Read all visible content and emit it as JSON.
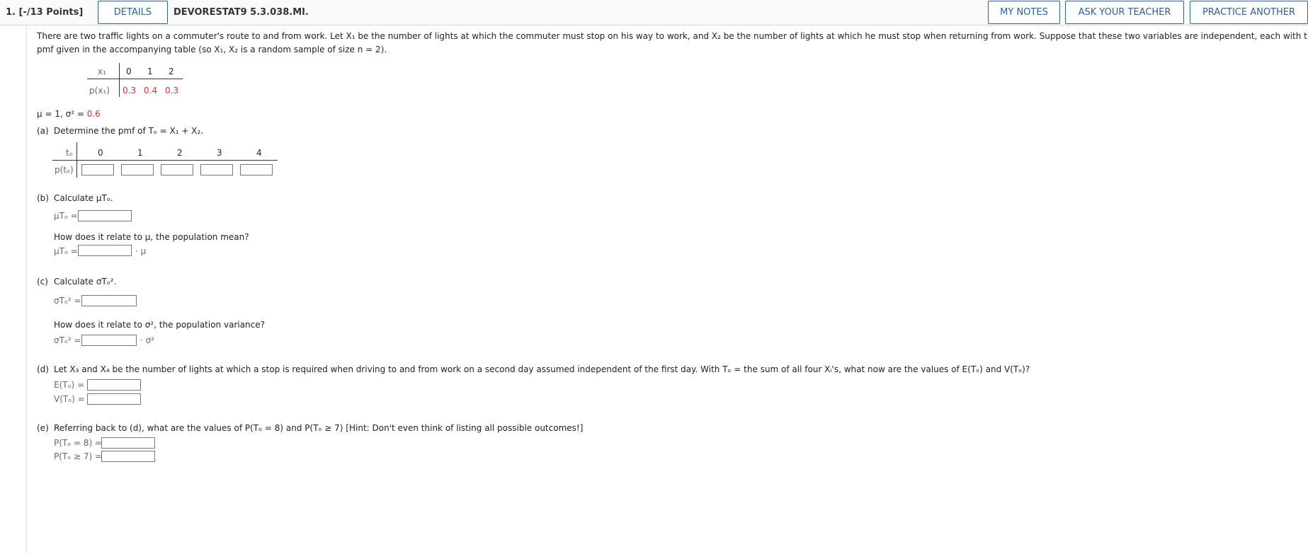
{
  "header": {
    "question_number": "1. [-/13 Points]",
    "details_label": "DETAILS",
    "problem_code": "DEVORESTAT9 5.3.038.MI.",
    "my_notes_label": "MY NOTES",
    "ask_teacher_label": "ASK YOUR TEACHER",
    "practice_another_label": "PRACTICE ANOTHER"
  },
  "problem": {
    "intro_line1": "There are two traffic lights on a commuter's route to and from work. Let X₁ be the number of lights at which the commuter must stop on his way to work, and X₂ be the number of lights at which he must stop when returning from work. Suppose that these two variables are independent, each with the",
    "intro_line2": "pmf given in the accompanying table (so X₁, X₂ is a random sample of size n = 2).",
    "pmf_table": {
      "row1_label": "x₁",
      "values": [
        "0",
        "1",
        "2"
      ],
      "row2_label": "p(x₁)",
      "probs": [
        "0.3",
        "0.4",
        "0.3"
      ]
    },
    "mu_line": "μ = 1, σ² = ",
    "sigma_sq": "0.6"
  },
  "part_a": {
    "label": "(a)",
    "prompt": "Determine the pmf of Tₒ = X₁ + X₂.",
    "table_row1_label": "tₒ",
    "table_values": [
      "0",
      "1",
      "2",
      "3",
      "4"
    ],
    "table_row2_label": "p(tₒ)"
  },
  "part_b": {
    "label": "(b)",
    "prompt": "Calculate μTₒ.",
    "mean_label": "μTₒ =",
    "relate_prompt": "How does it relate to μ, the population mean?",
    "relate_label": "μTₒ =",
    "relate_suffix": "· μ"
  },
  "part_c": {
    "label": "(c)",
    "prompt": "Calculate σTₒ².",
    "var_label": "σTₒ² =",
    "relate_prompt": "How does it relate to σ², the population variance?",
    "relate_label": "σTₒ² =",
    "relate_suffix": "· σ²"
  },
  "part_d": {
    "label": "(d)",
    "prompt": "Let X₃ and X₄ be the number of lights at which a stop is required when driving to and from work on a second day assumed independent of the first day. With Tₒ = the sum of all four Xᵢ's, what now are the values of E(Tₒ) and V(Tₒ)?",
    "e_label": "E(Tₒ) =",
    "v_label": "V(Tₒ) ="
  },
  "part_e": {
    "label": "(e)",
    "prompt": "Referring back to (d), what are the values of P(Tₒ = 8) and P(Tₒ ≥ 7) [Hint: Don't even think of listing all possible outcomes!]",
    "p8_label": "P(Tₒ = 8) =",
    "p7_label": "P(Tₒ ≥ 7) ="
  }
}
